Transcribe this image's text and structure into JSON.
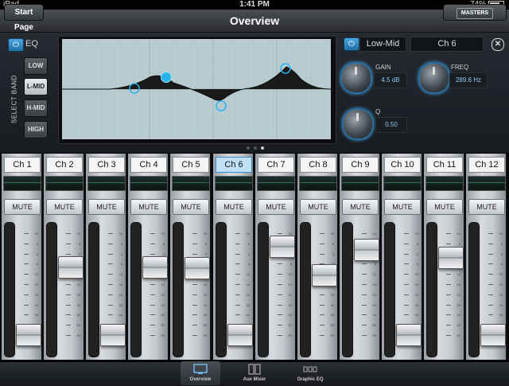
{
  "status_bar": {
    "device": "iPad",
    "time": "1:41 PM",
    "battery": "74%"
  },
  "nav": {
    "title": "Overview",
    "start_button": "Start Page",
    "masters_button": "MASTERS"
  },
  "eq": {
    "label": "EQ",
    "select_band_label": "SELECT BAND",
    "bands": [
      "LOW",
      "L-MID",
      "H-MID",
      "HIGH"
    ],
    "selected_band": "L-MID",
    "band_name": "Low-Mid",
    "channel_name": "Ch 6",
    "gain_label": "GAIN",
    "gain_value": "4.5 dB",
    "freq_label": "FREQ",
    "freq_value": "289.6 Hz",
    "q_label": "Q",
    "q_value": "0.50"
  },
  "channels": [
    {
      "name": "Ch 1",
      "fader": 0.1
    },
    {
      "name": "Ch 2",
      "fader": 0.7
    },
    {
      "name": "Ch 3",
      "fader": 0.1
    },
    {
      "name": "Ch 4",
      "fader": 0.7
    },
    {
      "name": "Ch 5",
      "fader": 0.69
    },
    {
      "name": "Ch 6",
      "fader": 0.1
    },
    {
      "name": "Ch 7",
      "fader": 0.88
    },
    {
      "name": "Ch 8",
      "fader": 0.63
    },
    {
      "name": "Ch 9",
      "fader": 0.85
    },
    {
      "name": "Ch 10",
      "fader": 0.1
    },
    {
      "name": "Ch 11",
      "fader": 0.78
    },
    {
      "name": "Ch 12",
      "fader": 0.1
    }
  ],
  "selected_channel": "Ch 6",
  "mute_label": "MUTE",
  "fader_scale": [
    "10",
    "5",
    "0",
    "5",
    "10",
    "15",
    "20",
    "30",
    "40",
    "60",
    "90"
  ],
  "tabs": [
    {
      "label": "Overview",
      "selected": true
    },
    {
      "label": "Aux Mixer",
      "selected": false
    },
    {
      "label": "Graphic EQ",
      "selected": false
    }
  ],
  "colors": {
    "accent": "#3aa0e0",
    "eq_curve": "#1a1a1a"
  }
}
